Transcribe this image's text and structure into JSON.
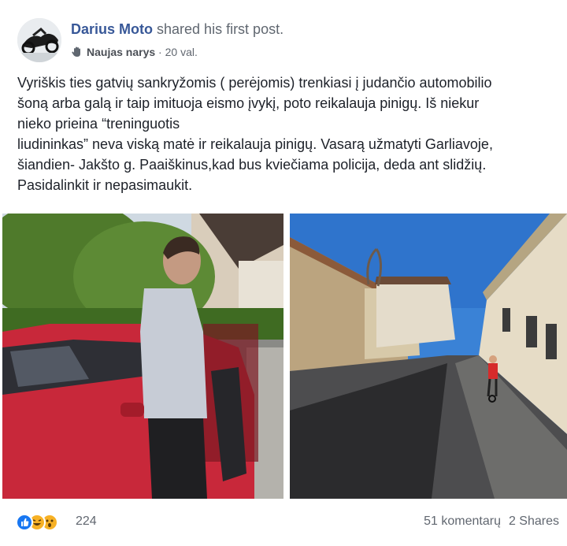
{
  "author": {
    "name": "Darius Moto",
    "action": " shared his first post.",
    "badge": "Naujas narys",
    "separator": " · ",
    "time": "20 val."
  },
  "post": {
    "lines": [
      "Vyriškis ties gatvių sankryžomis ( perėjomis) trenkiasi į judančio automobilio",
      "šoną arba galą ir taip imituoja eismo įvykį, poto reikalauja pinigų. Iš niekur",
      "nieko prieina “treninguotis",
      "liudininkas” neva viską matė ir reikalauja pinigų. Vasarą užmatyti Garliavoje,",
      "šiandien- Jakšto g. Paaiškinus,kad bus kviečiama policija, deda ant slidžių.",
      "Pasidalinkit ir nepasimaukit."
    ]
  },
  "photos": {
    "left_icon": "photo-man-by-red-car",
    "right_icon": "photo-street-with-cyclist"
  },
  "stats": {
    "reactions": [
      "like-icon",
      "haha-icon",
      "wow-icon"
    ],
    "reaction_count": "224",
    "comments": "51 komentarų",
    "shares": "2 Shares"
  },
  "colors": {
    "link": "#385898",
    "meta": "#616770",
    "text": "#1d2129",
    "like": "#1877f2",
    "emoji": "#f7b125"
  }
}
